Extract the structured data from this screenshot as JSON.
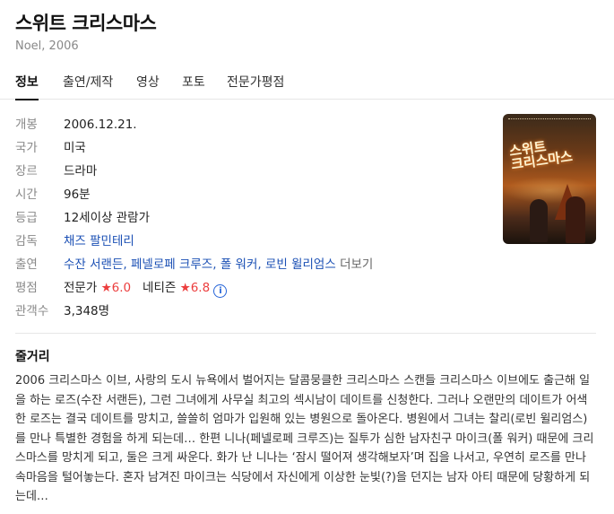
{
  "header": {
    "title": "스위트 크리스마스",
    "subtitle": "Noel, 2006"
  },
  "tabs": [
    {
      "label": "정보",
      "active": true
    },
    {
      "label": "출연/제작",
      "active": false
    },
    {
      "label": "영상",
      "active": false
    },
    {
      "label": "포토",
      "active": false
    },
    {
      "label": "전문가평점",
      "active": false
    }
  ],
  "info": {
    "release": {
      "label": "개봉",
      "value": "2006.12.21."
    },
    "country": {
      "label": "국가",
      "value": "미국"
    },
    "genre": {
      "label": "장르",
      "value": "드라마"
    },
    "runtime": {
      "label": "시간",
      "value": "96분"
    },
    "rating": {
      "label": "등급",
      "value": "12세이상 관람가"
    },
    "director": {
      "label": "감독",
      "value": "채즈 팔민테리"
    },
    "cast": {
      "label": "출연",
      "names": [
        "수잔 서랜든,",
        "페넬로페 크루즈,",
        "폴 워커,",
        "로빈 윌리엄스"
      ],
      "more": "더보기"
    },
    "score": {
      "label": "평점",
      "expert_label": "전문가",
      "expert_value": "6.0",
      "netizen_label": "네티즌",
      "netizen_value": "6.8"
    },
    "audience": {
      "label": "관객수",
      "value": "3,348명"
    }
  },
  "poster": {
    "title_line1": "스위트",
    "title_line2": "크리스마스"
  },
  "synopsis": {
    "heading": "줄거리",
    "text": "2006 크리스마스 이브, 사랑의 도시 뉴욕에서 벌어지는 달콤뭉클한 크리스마스 스캔들 크리스마스 이브에도 출근해 일을 하는 로즈(수잔 서랜든), 그런 그녀에게 사무실 최고의 섹시남이 데이트를 신청한다. 그러나 오랜만의 데이트가 어색한 로즈는 결국 데이트를 망치고, 쓸쓸히 엄마가 입원해 있는 병원으로 돌아온다. 병원에서 그녀는 찰리(로빈 윌리엄스)를 만나 특별한 경험을 하게 되는데… 한편 니나(페넬로페 크루즈)는 질투가 심한 남자친구 마이크(폴 워커) 때문에 크리스마스를 망치게 되고, 둘은 크게 싸운다. 화가 난 니나는 ‘잠시 떨어져 생각해보자’며 집을 나서고, 우연히 로즈를 만나 속마음을 털어놓는다. 혼자 남겨진 마이크는 식당에서 자신에게 이상한 눈빛(?)을 던지는 남자 아티 때문에 당황하게 되는데…"
  },
  "colors": {
    "link": "#1a4fb4",
    "star": "#ec3e3e",
    "label": "#888888"
  }
}
